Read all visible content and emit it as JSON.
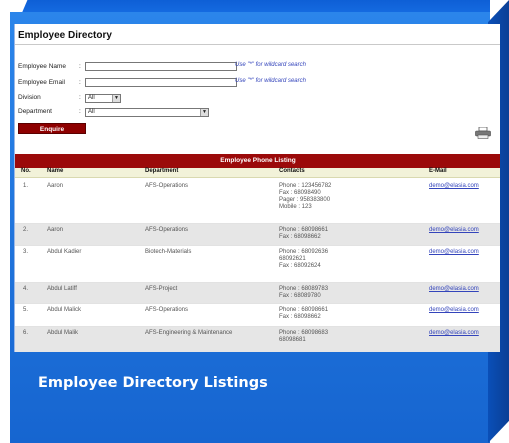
{
  "directory": {
    "title": "Employee Directory",
    "form": {
      "name_label": "Employee Name",
      "email_label": "Employee Email",
      "division_label": "Division",
      "department_label": "Department",
      "wildcard_hint": "Use \"*\" for wildcard search",
      "division_value": "All",
      "department_value": "All",
      "enquire_label": "Enquire"
    },
    "listing": {
      "title": "Employee Phone Listing",
      "columns": [
        "No.",
        "Name",
        "Department",
        "Contacts",
        "E-Mail"
      ],
      "rows": [
        {
          "no": "1.",
          "name": "Aaron",
          "department": "AFS-Operations",
          "contacts": [
            "Phone : 123456782",
            "Fax :    68098490",
            "Pager : 958383800",
            "Mobile : 123"
          ],
          "email": "demo@elasia.com"
        },
        {
          "no": "2.",
          "name": "Aaron",
          "department": "AFS-Operations",
          "contacts": [
            "Phone : 68098661",
            "Fax :    68098662"
          ],
          "email": "demo@elasia.com"
        },
        {
          "no": "3.",
          "name": "Abdul Kadier",
          "department": "Biotech-Materials",
          "contacts": [
            "Phone : 68092636",
            "           68092621",
            "Fax :    68092624"
          ],
          "email": "demo@elasia.com"
        },
        {
          "no": "4.",
          "name": "Abdul Latiff",
          "department": "AFS-Project",
          "contacts": [
            "Phone : 68089783",
            "Fax :    68089780"
          ],
          "email": "demo@elasia.com"
        },
        {
          "no": "5.",
          "name": "Abdul Malick",
          "department": "AFS-Operations",
          "contacts": [
            "Phone : 68098661",
            "Fax :    68098662"
          ],
          "email": "demo@elasia.com"
        },
        {
          "no": "6.",
          "name": "Abdul Malik",
          "department": "AFS-Engineering & Maintenance",
          "contacts": [
            "Phone : 68098683",
            "           68098681"
          ],
          "email": "demo@elasia.com"
        }
      ]
    }
  },
  "caption": "Employee Directory Listings",
  "colors": {
    "box_blue": "#1a6fdf",
    "header_red": "#9b0a0a",
    "button_red": "#8e0000",
    "link_blue": "#3344bb"
  }
}
